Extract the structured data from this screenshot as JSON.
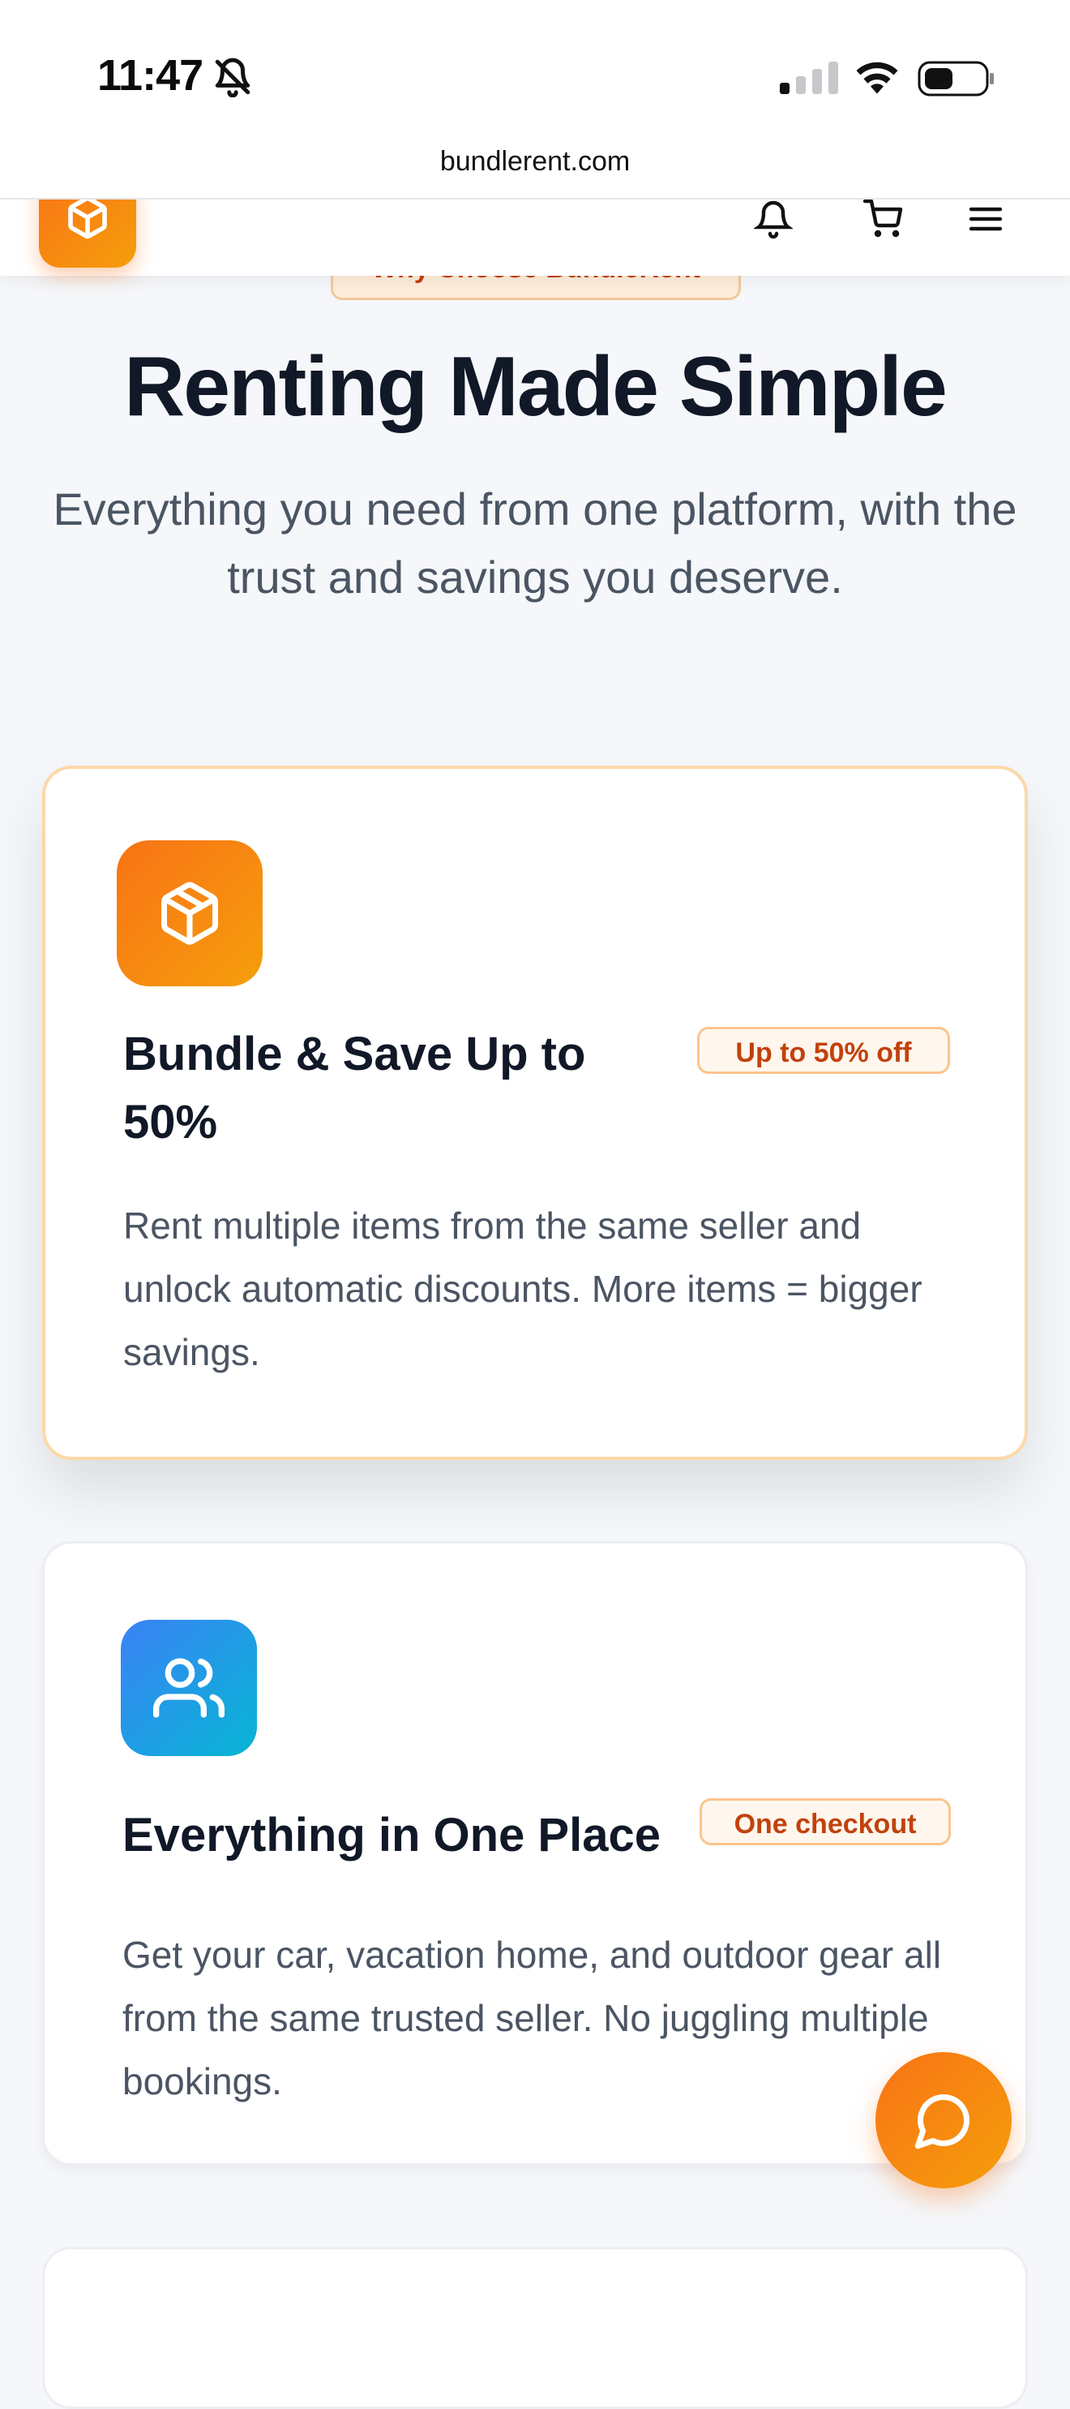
{
  "status_bar": {
    "time": "11:47"
  },
  "browser": {
    "url": "bundlerent.com"
  },
  "hero": {
    "pill_label": "Why Choose BundleRent",
    "title": "Renting Made Simple",
    "subtitle": "Everything you need from one platform, with the trust and savings you deserve."
  },
  "features": [
    {
      "title": "Bundle & Save Up to 50%",
      "badge": "Up to 50% off",
      "description": "Rent multiple items from the same seller and unlock automatic discounts. More items = bigger savings.",
      "icon": "package-icon"
    },
    {
      "title": "Everything in One Place",
      "badge": "One checkout",
      "description": "Get your car, vacation home, and outdoor gear all from the same trusted seller. No juggling multiple bookings.",
      "icon": "users-icon"
    }
  ],
  "colors": {
    "accent": "#f97316",
    "accent_light": "#f59e0b",
    "blue": "#3b82f6",
    "cyan": "#06b6d4"
  }
}
